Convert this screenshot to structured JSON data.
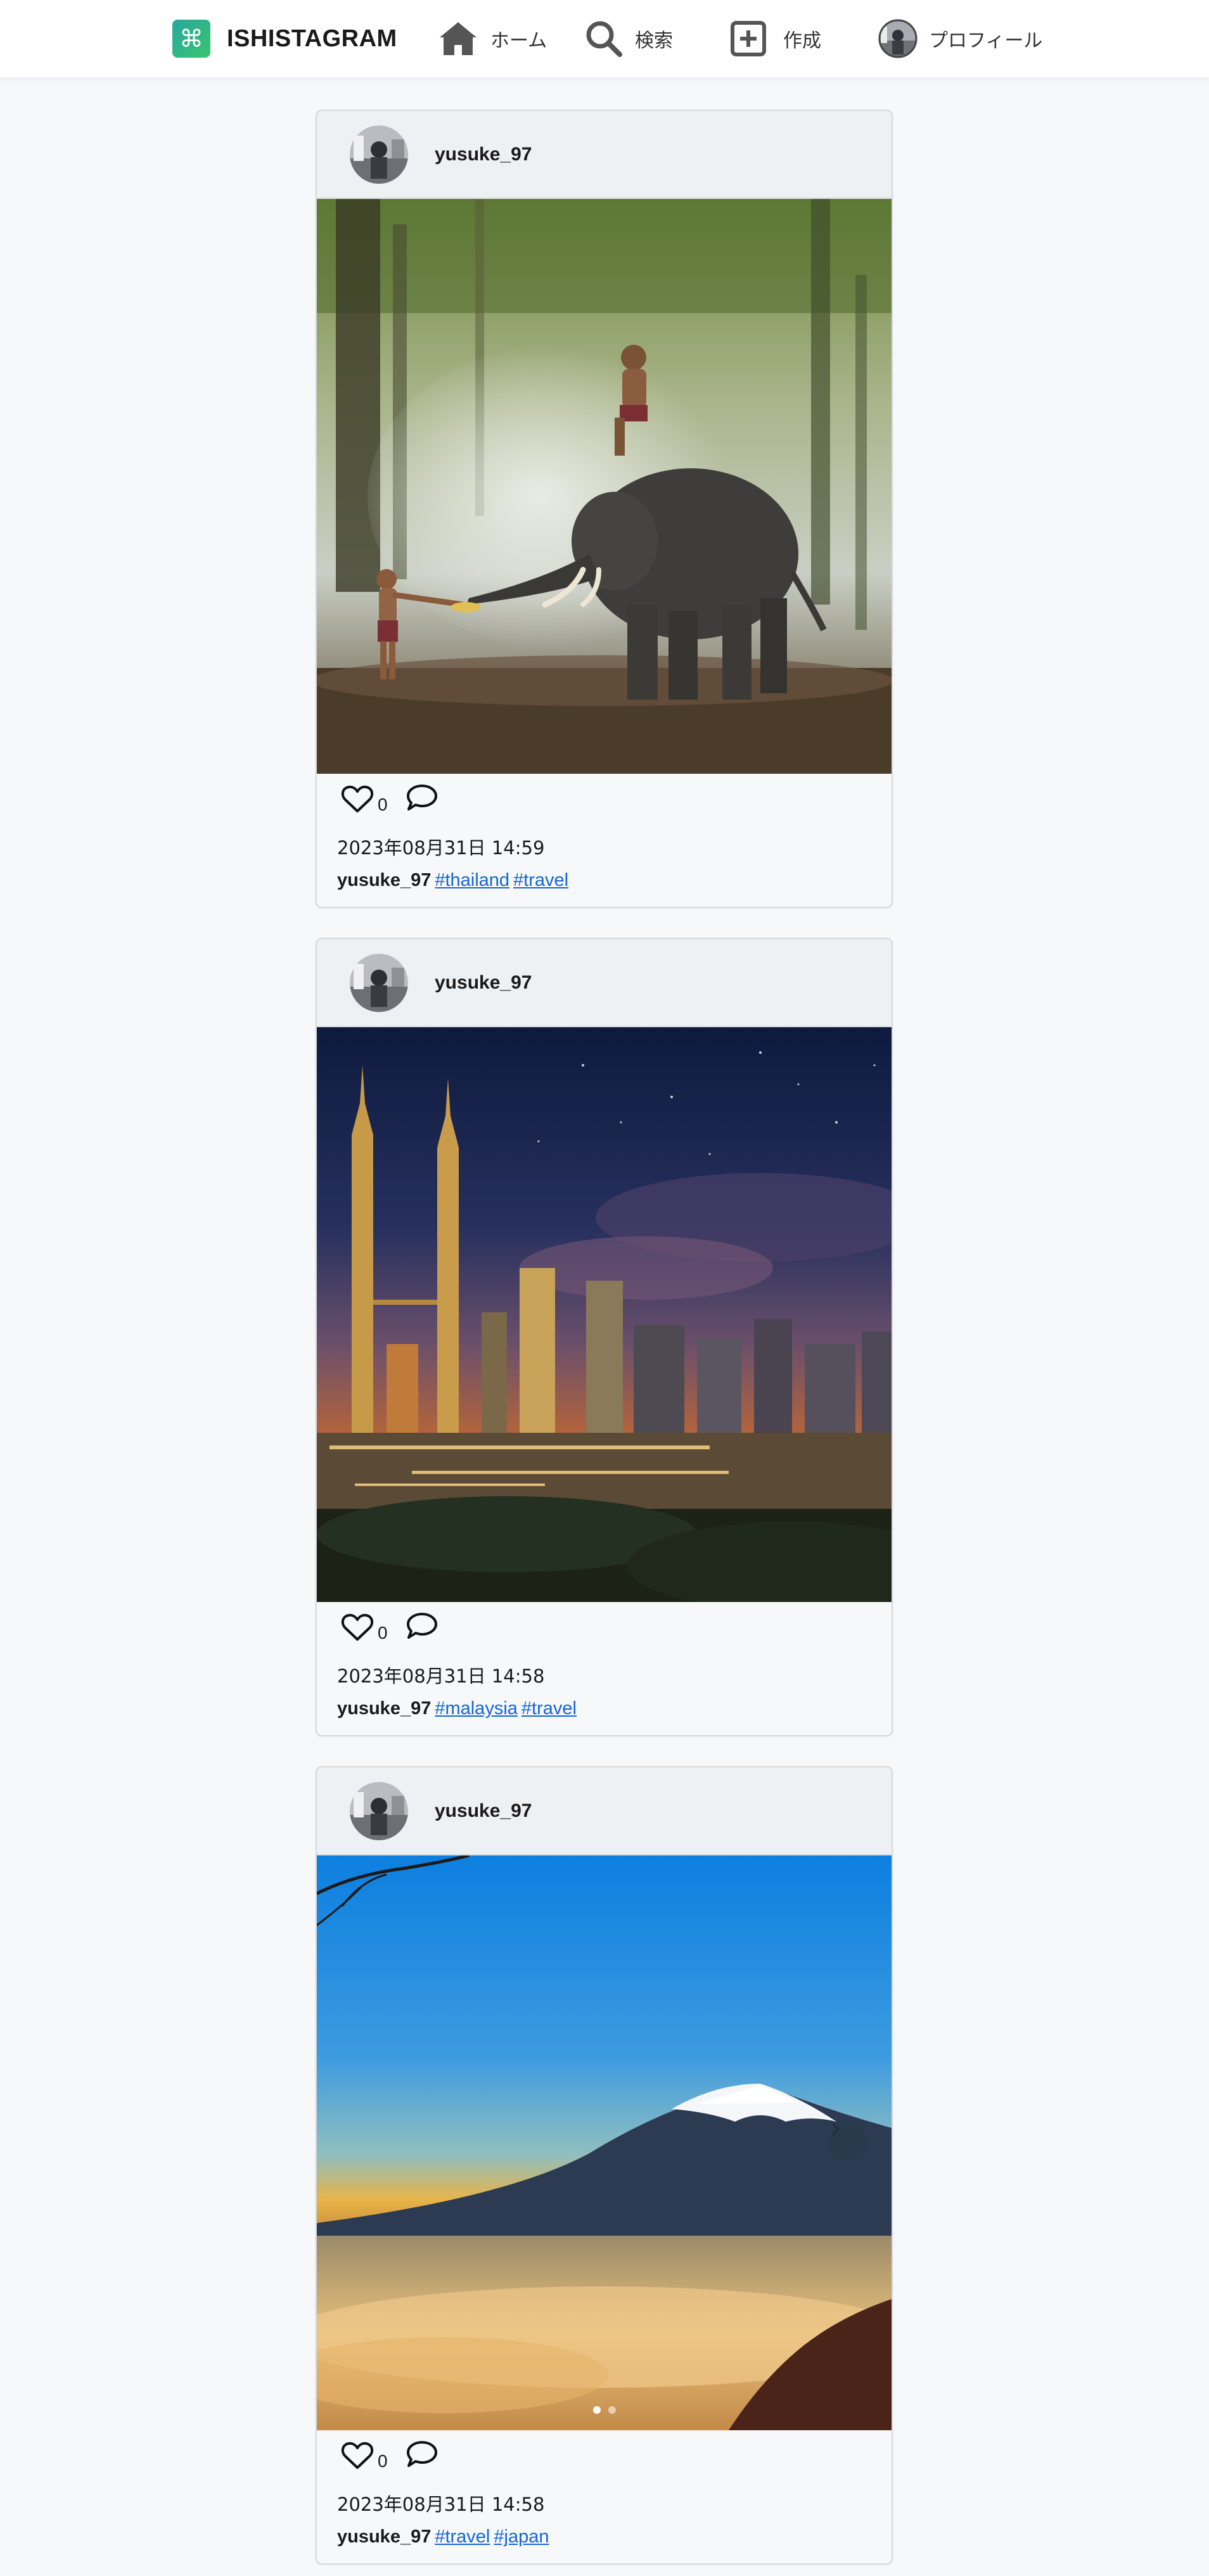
{
  "header": {
    "brand_name": "ISHISTAGRAM",
    "brand_icon": "command-icon",
    "nav": [
      {
        "label": "ホーム",
        "icon": "home-icon"
      },
      {
        "label": "検索",
        "icon": "search-icon"
      },
      {
        "label": "作成",
        "icon": "plus-square-icon"
      },
      {
        "label": "プロフィール",
        "icon": "avatar"
      }
    ]
  },
  "posts": [
    {
      "username": "yusuke_97",
      "likes": "0",
      "date": "2023年08月31日 14:59",
      "caption_user": "yusuke_97",
      "tags": [
        "#thailand",
        "#travel"
      ],
      "photo": "elephant-forest-photo"
    },
    {
      "username": "yusuke_97",
      "likes": "0",
      "date": "2023年08月31日 14:58",
      "caption_user": "yusuke_97",
      "tags": [
        "#malaysia",
        "#travel"
      ],
      "photo": "city-night-skyline-photo"
    },
    {
      "username": "yusuke_97",
      "likes": "0",
      "date": "2023年08月31日 14:58",
      "caption_user": "yusuke_97",
      "tags": [
        "#travel",
        "#japan"
      ],
      "photo": "mount-fuji-photo",
      "carousel": {
        "slides": 2,
        "active": 1
      }
    }
  ],
  "colors": {
    "accent_link": "#1565d8",
    "brand_gradient_start": "#27a7a0",
    "brand_gradient_end": "#3ac56d"
  }
}
